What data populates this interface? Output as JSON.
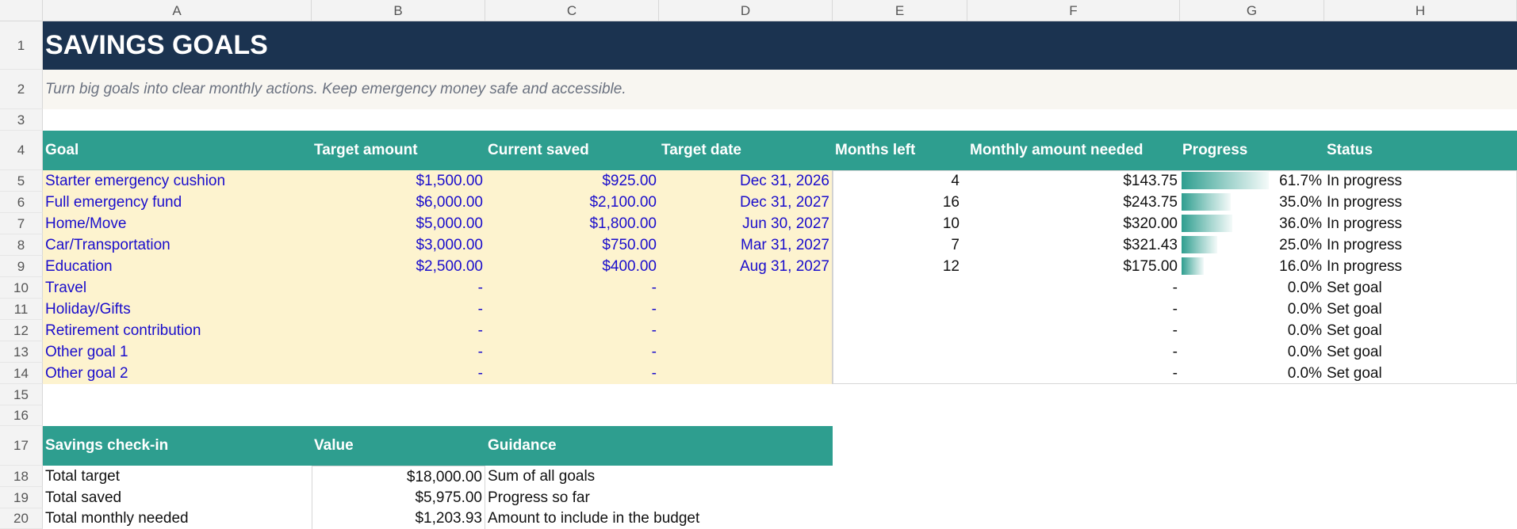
{
  "colors": {
    "title_bg": "#1b3350",
    "subtitle_bg": "#f8f6f1",
    "header_bg": "#2e9e8f",
    "input_bg": "#fdf3cf",
    "input_text": "#1a0dcc",
    "bar": "#2e9e8f"
  },
  "columns": [
    "A",
    "B",
    "C",
    "D",
    "E",
    "F",
    "G",
    "H"
  ],
  "rows": [
    "1",
    "2",
    "3",
    "4",
    "5",
    "6",
    "7",
    "8",
    "9",
    "10",
    "11",
    "12",
    "13",
    "14",
    "15",
    "16",
    "17",
    "18",
    "19",
    "20"
  ],
  "title": "SAVINGS GOALS",
  "subtitle": "Turn big goals into clear monthly actions. Keep emergency money safe and accessible.",
  "goals_table": {
    "headers": [
      "Goal",
      "Target amount",
      "Current saved",
      "Target date",
      "Months left",
      "Monthly amount needed",
      "Progress",
      "Status"
    ],
    "rows": [
      {
        "goal": "Starter emergency cushion",
        "target": "$1,500.00",
        "saved": "$925.00",
        "date": "Dec 31, 2026",
        "months": "4",
        "monthly": "$143.75",
        "progress_text": "61.7%",
        "progress": 0.617,
        "status": "In progress"
      },
      {
        "goal": "Full emergency fund",
        "target": "$6,000.00",
        "saved": "$2,100.00",
        "date": "Dec 31, 2027",
        "months": "16",
        "monthly": "$243.75",
        "progress_text": "35.0%",
        "progress": 0.35,
        "status": "In progress"
      },
      {
        "goal": "Home/Move",
        "target": "$5,000.00",
        "saved": "$1,800.00",
        "date": "Jun 30, 2027",
        "months": "10",
        "monthly": "$320.00",
        "progress_text": "36.0%",
        "progress": 0.36,
        "status": "In progress"
      },
      {
        "goal": "Car/Transportation",
        "target": "$3,000.00",
        "saved": "$750.00",
        "date": "Mar 31, 2027",
        "months": "7",
        "monthly": "$321.43",
        "progress_text": "25.0%",
        "progress": 0.25,
        "status": "In progress"
      },
      {
        "goal": "Education",
        "target": "$2,500.00",
        "saved": "$400.00",
        "date": "Aug 31, 2027",
        "months": "12",
        "monthly": "$175.00",
        "progress_text": "16.0%",
        "progress": 0.16,
        "status": "In progress"
      },
      {
        "goal": "Travel",
        "target": "-",
        "saved": "-",
        "date": "",
        "months": "",
        "monthly": "-",
        "progress_text": "0.0%",
        "progress": 0,
        "status": "Set goal"
      },
      {
        "goal": "Holiday/Gifts",
        "target": "-",
        "saved": "-",
        "date": "",
        "months": "",
        "monthly": "-",
        "progress_text": "0.0%",
        "progress": 0,
        "status": "Set goal"
      },
      {
        "goal": "Retirement contribution",
        "target": "-",
        "saved": "-",
        "date": "",
        "months": "",
        "monthly": "-",
        "progress_text": "0.0%",
        "progress": 0,
        "status": "Set goal"
      },
      {
        "goal": "Other goal 1",
        "target": "-",
        "saved": "-",
        "date": "",
        "months": "",
        "monthly": "-",
        "progress_text": "0.0%",
        "progress": 0,
        "status": "Set goal"
      },
      {
        "goal": "Other goal 2",
        "target": "-",
        "saved": "-",
        "date": "",
        "months": "",
        "monthly": "-",
        "progress_text": "0.0%",
        "progress": 0,
        "status": "Set goal"
      }
    ]
  },
  "checkin_table": {
    "headers": [
      "Savings check-in",
      "Value",
      "Guidance"
    ],
    "rows": [
      {
        "label": "Total target",
        "value": "$18,000.00",
        "guidance": "Sum of all goals"
      },
      {
        "label": "Total saved",
        "value": "$5,975.00",
        "guidance": "Progress so far"
      },
      {
        "label": "Total monthly needed",
        "value": "$1,203.93",
        "guidance": "Amount to include in the budget"
      }
    ]
  }
}
